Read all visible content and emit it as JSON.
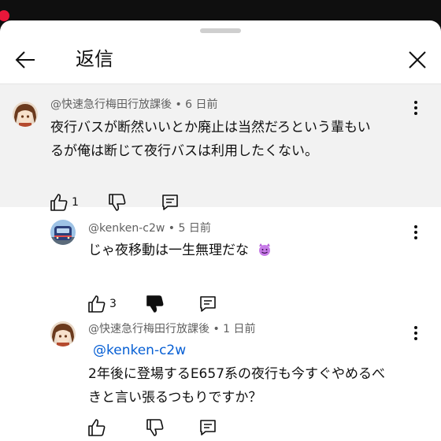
{
  "header": {
    "title": "返信",
    "back_icon": "arrow-left-icon",
    "close_icon": "close-icon"
  },
  "parent_comment": {
    "author": "@快速急行梅田行放課後",
    "time": "6 日前",
    "text_line1": "夜行バスが断然いいとか廃止は当然だろという輩もい",
    "text_line2": "るが俺は断じて夜行バスは利用したくない。",
    "likes": "1"
  },
  "replies": [
    {
      "author": "@kenken-c2w",
      "time": "5 日前",
      "text": "じゃ夜移動は一生無理だな",
      "emoji": "smiling-face-with-horns",
      "likes": "3",
      "dislike_active": true
    },
    {
      "author": "@快速急行梅田行放課後",
      "time": "1 日前",
      "mention": "@kenken-c2w",
      "text_line1": "2年後に登場するE657系の夜行も今すぐやめるべ",
      "text_line2": "きと言い張るつもりですか？"
    }
  ],
  "colors": {
    "parent_bg": "#f2f2f2",
    "mention": "#065fd4",
    "meta": "#606060",
    "record_dot": "#e8173a"
  },
  "separator": "•"
}
